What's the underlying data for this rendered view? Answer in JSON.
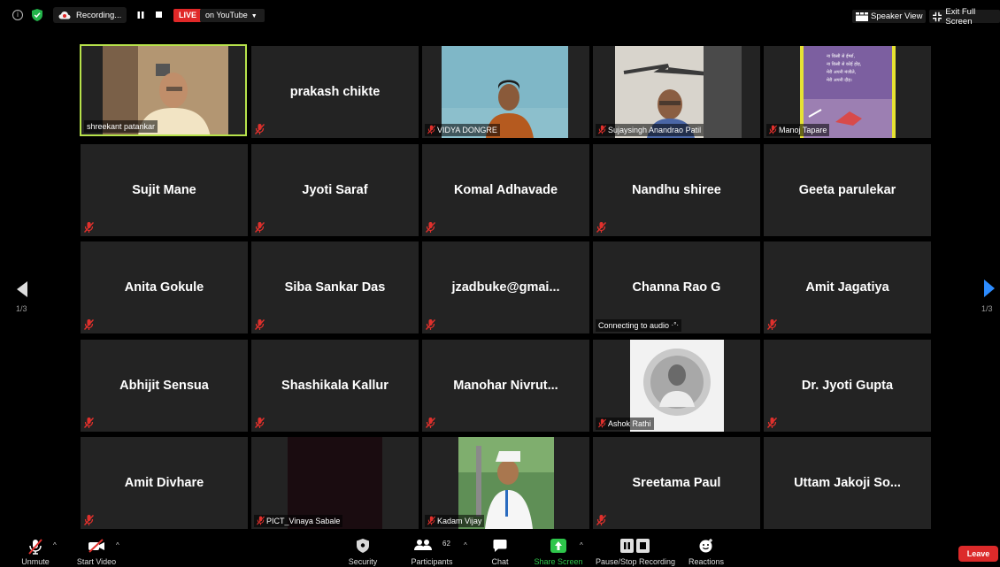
{
  "topbar": {
    "recording_label": "Recording...",
    "live_label": "LIVE",
    "live_destination": "on YouTube",
    "speaker_view_label": "Speaker View",
    "exit_fullscreen_label": "Exit Full Screen"
  },
  "gallery": {
    "page_left": "1/3",
    "page_right": "1/3",
    "tiles": [
      {
        "name": "",
        "label": "shreekant patankar"
      },
      {
        "name": "prakash chikte",
        "label": ""
      },
      {
        "name": "",
        "label": "VIDYA DONGRE"
      },
      {
        "name": "",
        "label": "Sujaysingh Anandrao Patil"
      },
      {
        "name": "",
        "label": "Manoj Tapare"
      },
      {
        "name": "Sujit Mane",
        "label": ""
      },
      {
        "name": "Jyoti Saraf",
        "label": ""
      },
      {
        "name": "Komal Adhavade",
        "label": ""
      },
      {
        "name": "Nandhu shiree",
        "label": ""
      },
      {
        "name": "Geeta parulekar",
        "label": ""
      },
      {
        "name": "Anita Gokule",
        "label": ""
      },
      {
        "name": "Siba Sankar Das",
        "label": ""
      },
      {
        "name": "jzadbuke@gmai...",
        "label": ""
      },
      {
        "name": "Channa Rao G",
        "label": "Connecting to audio"
      },
      {
        "name": "Amit Jagatiya",
        "label": ""
      },
      {
        "name": "Abhijit Sensua",
        "label": ""
      },
      {
        "name": "Shashikala Kallur",
        "label": ""
      },
      {
        "name": "Manohar  Nivrut...",
        "label": ""
      },
      {
        "name": "",
        "label": "Ashok Rathi"
      },
      {
        "name": "Dr. Jyoti Gupta",
        "label": ""
      },
      {
        "name": "Amit Divhare",
        "label": ""
      },
      {
        "name": "",
        "label": "PICT_Vinaya Sabale"
      },
      {
        "name": "",
        "label": "Kadam Vijay"
      },
      {
        "name": "Sreetama Paul",
        "label": ""
      },
      {
        "name": "Uttam Jakoji So...",
        "label": ""
      }
    ],
    "poster_lines": [
      "ना किसी से ईर्ष्या,",
      "ना किसी से कोई होड़,",
      "मेरी अपनी मंजीले,",
      "मेरी अपनी दौड़।"
    ]
  },
  "toolbar": {
    "unmute": "Unmute",
    "start_video": "Start Video",
    "security": "Security",
    "participants": "Participants",
    "participants_count": "62",
    "chat": "Chat",
    "share_screen": "Share Screen",
    "pause_stop_recording": "Pause/Stop Recording",
    "reactions": "Reactions",
    "leave": "Leave"
  },
  "colors": {
    "tile_bg": "#232323",
    "active_speaker_border": "#b7e24b",
    "share_green": "#2ec64b",
    "leave_red": "#dc2a2a",
    "live_red": "#e02828",
    "mute_red": "#e0302c"
  }
}
